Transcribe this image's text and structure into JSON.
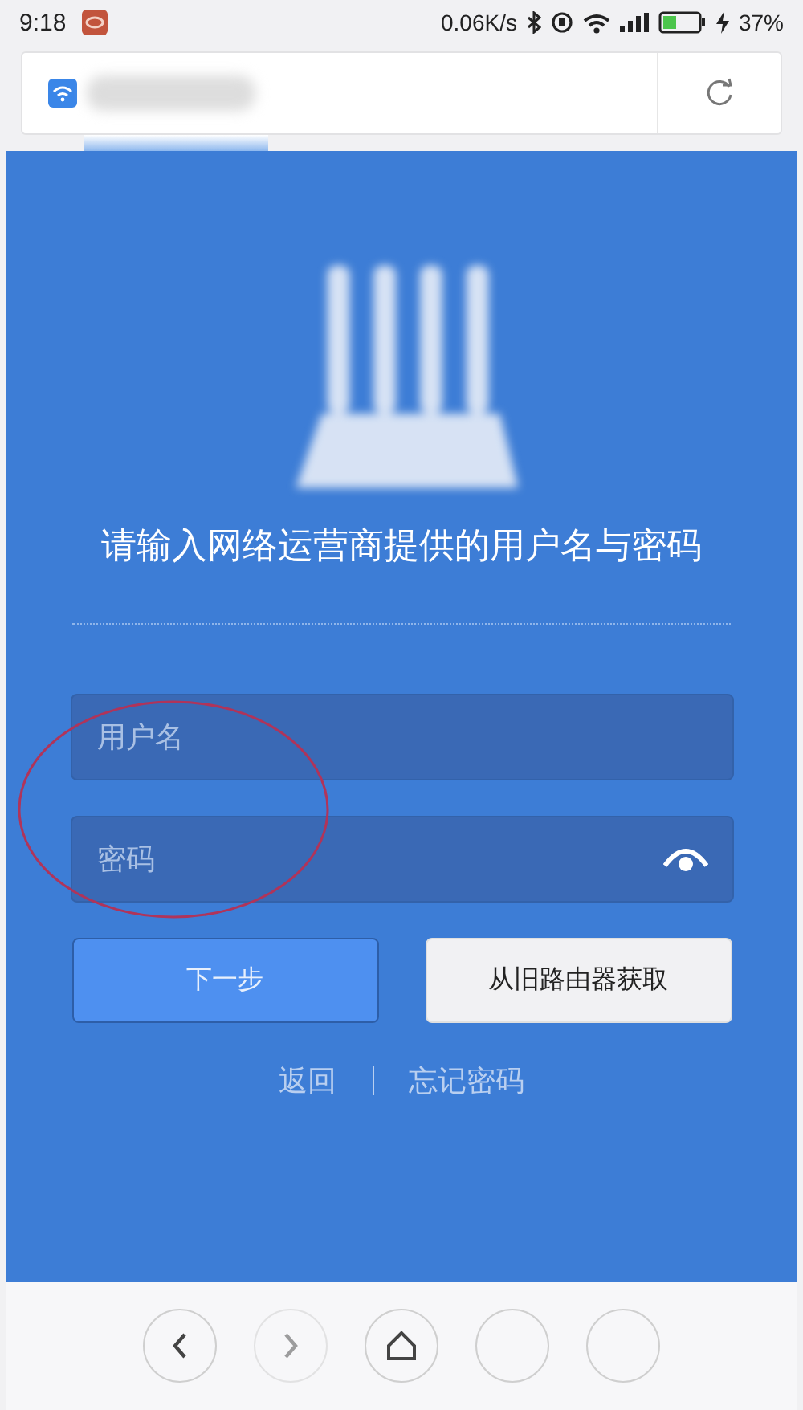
{
  "status_bar": {
    "time": "9:18",
    "speed": "0.06K/s",
    "battery": "37%"
  },
  "heading": "请输入网络运营商提供的用户名与密码",
  "fields": [
    {
      "kind": "text",
      "placeholder": "用户名"
    },
    {
      "kind": "password",
      "placeholder": "密码"
    }
  ],
  "buttons": [
    {
      "kind": "primary",
      "label": "下一步"
    },
    {
      "kind": "secondary",
      "label": "从旧路由器获取"
    }
  ],
  "links": [
    "返回",
    "忘记密码"
  ],
  "nav_buttons": [
    {
      "kind": "back",
      "disabled": false
    },
    {
      "kind": "forward",
      "disabled": true
    },
    {
      "kind": "home",
      "disabled": false
    },
    {
      "kind": "blank",
      "disabled": false
    },
    {
      "kind": "blank",
      "disabled": false
    }
  ]
}
